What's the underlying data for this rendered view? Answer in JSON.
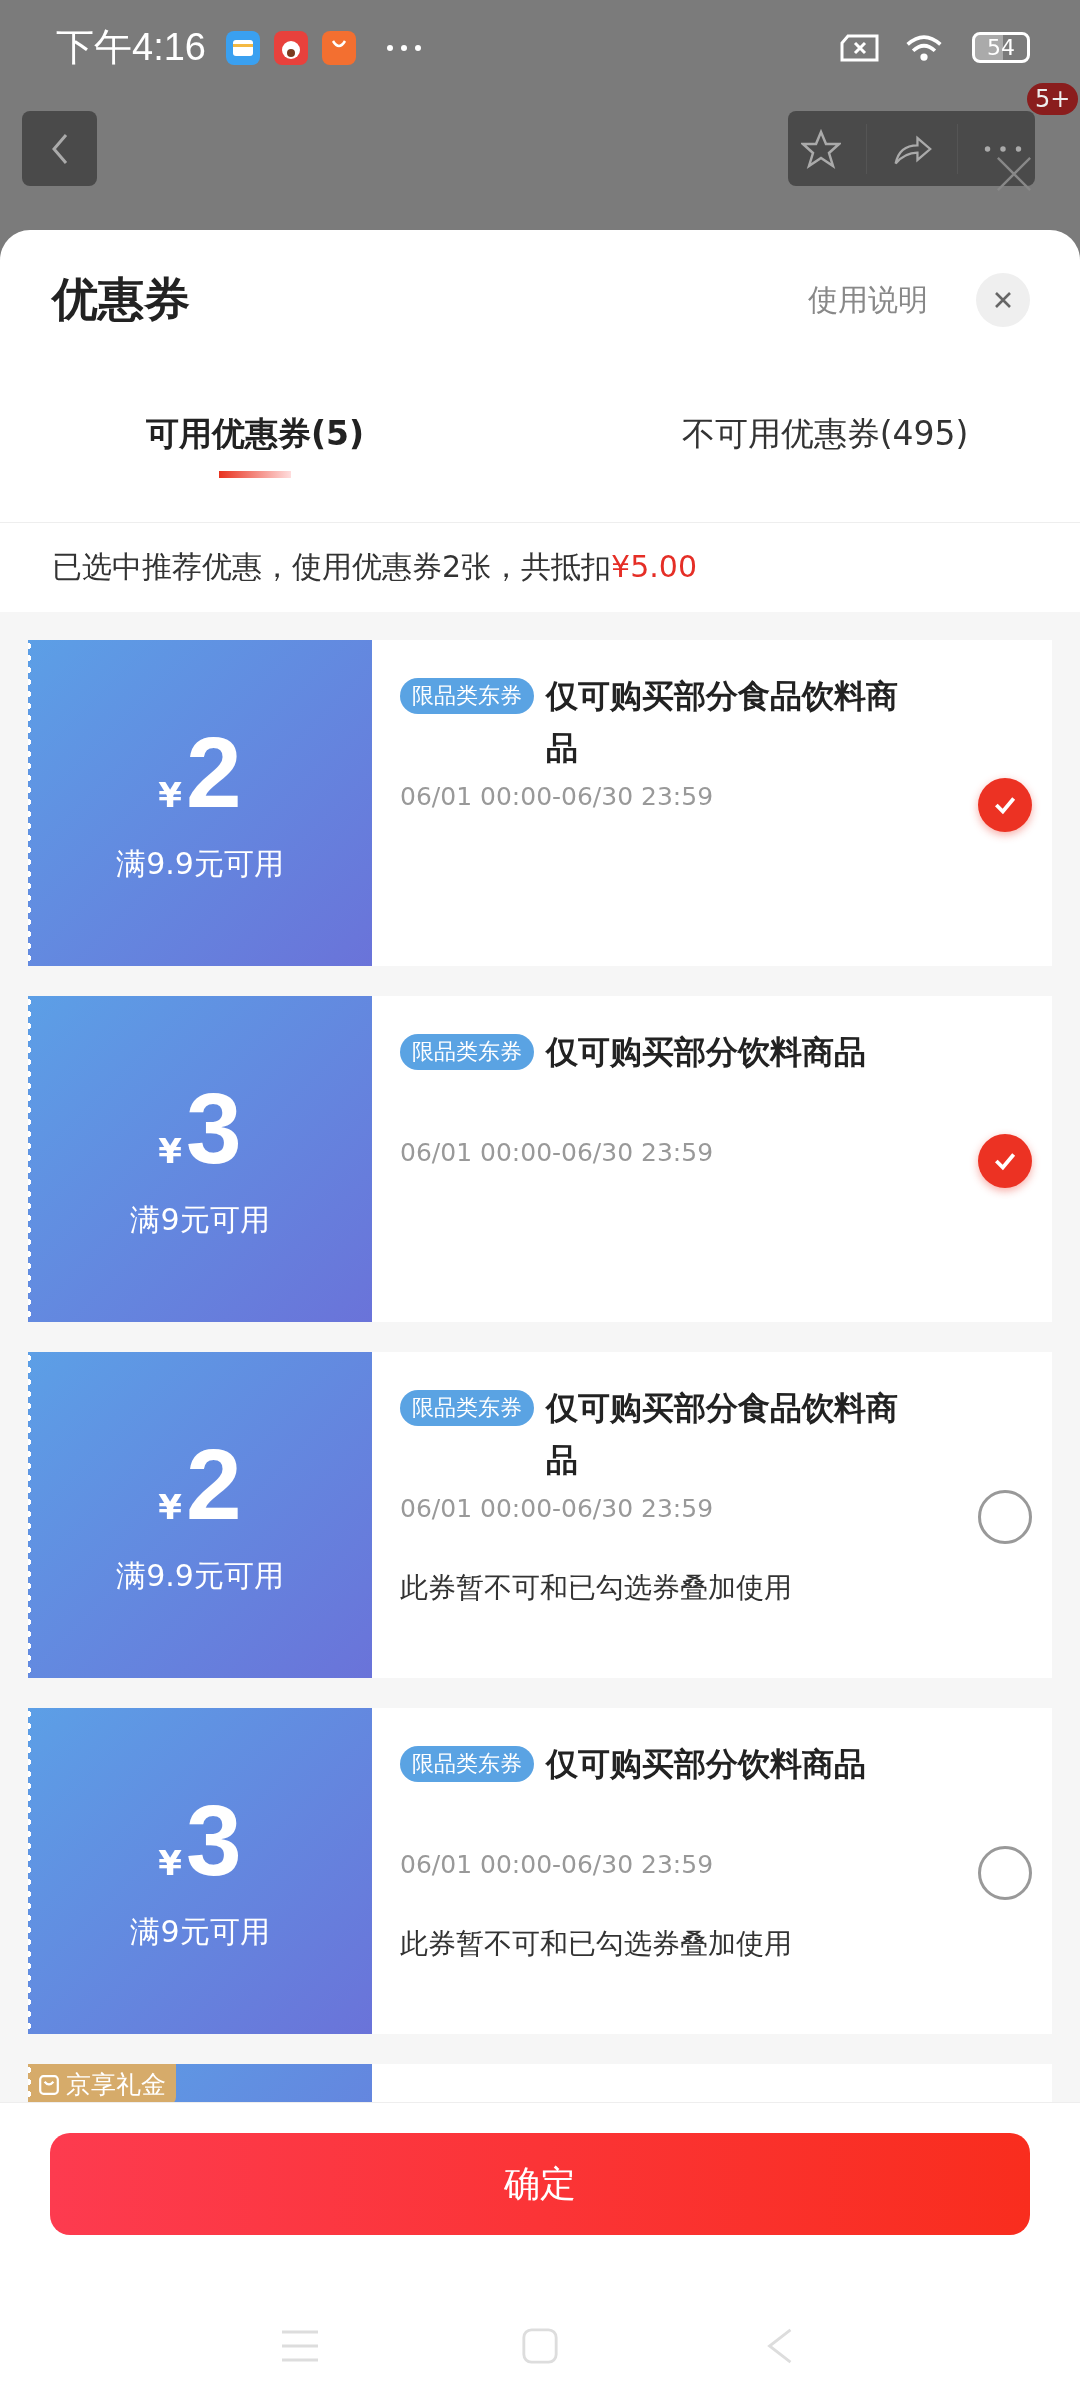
{
  "status_bar": {
    "time": "下午4:16",
    "battery": "54"
  },
  "top_bar": {
    "badge": "5+"
  },
  "sheet": {
    "title": "优惠券",
    "help_link": "使用说明"
  },
  "tabs": [
    {
      "label": "可用优惠券(5)",
      "selected": true
    },
    {
      "label": "不可用优惠券(495)",
      "selected": false
    }
  ],
  "summary": {
    "text": "已选中推荐优惠，使用优惠券2张，共抵扣",
    "amount": "¥5.00"
  },
  "coupons": [
    {
      "kind": "full",
      "currency": "¥",
      "amount": "2",
      "condition": "满9.9元可用",
      "tag": "限品类东券",
      "title": "仅可购买部分食品饮料商品",
      "period": "06/01 00:00-06/30 23:59",
      "checked": true
    },
    {
      "kind": "full",
      "currency": "¥",
      "amount": "3",
      "condition": "满9元可用",
      "tag": "限品类东券",
      "title": "仅可购买部分饮料商品",
      "period": "06/01 00:00-06/30 23:59",
      "checked": true
    },
    {
      "kind": "full",
      "currency": "¥",
      "amount": "2",
      "condition": "满9.9元可用",
      "tag": "限品类东券",
      "title": "仅可购买部分食品饮料商品",
      "period": "06/01 00:00-06/30 23:59",
      "note": "此券暂不可和已勾选券叠加使用",
      "checked": false
    },
    {
      "kind": "full",
      "currency": "¥",
      "amount": "3",
      "condition": "满9元可用",
      "tag": "限品类东券",
      "title": "仅可购买部分饮料商品",
      "period": "06/01 00:00-06/30 23:59",
      "note": "此券暂不可和已勾选券叠加使用",
      "checked": false
    },
    {
      "kind": "partial",
      "badge": "京享礼金"
    }
  ],
  "confirm_button": "确定"
}
